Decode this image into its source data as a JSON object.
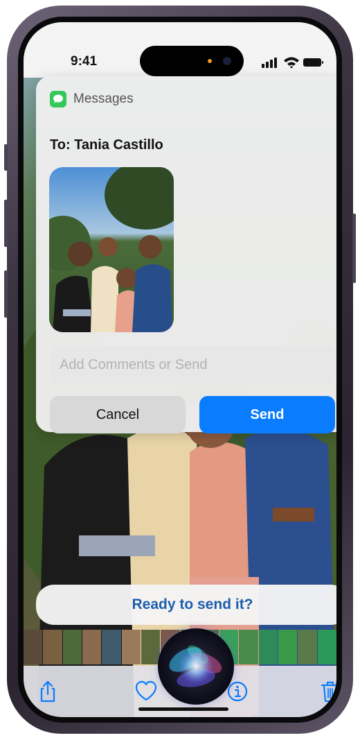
{
  "status_bar": {
    "time": "9:41"
  },
  "card": {
    "app_name": "Messages",
    "to_label": "To:",
    "recipient": "Tania Castillo",
    "comment_placeholder": "Add Comments or Send",
    "cancel_label": "Cancel",
    "send_label": "Send"
  },
  "siri": {
    "prompt": "Ready to send it?"
  },
  "toolbar": {
    "icons": [
      "share-icon",
      "heart-icon",
      "info-icon",
      "trash-icon"
    ]
  },
  "colors": {
    "accent": "#0a7cff",
    "messages_green": "#34c759",
    "siri_text": "#1d5dad"
  }
}
